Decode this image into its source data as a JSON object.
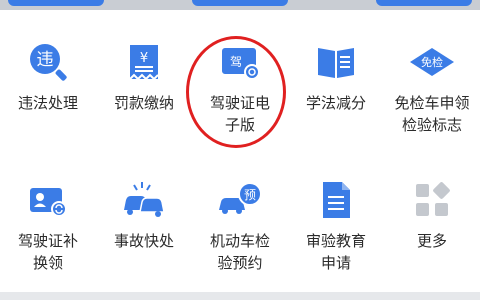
{
  "colors": {
    "accent": "#3b7ce6",
    "highlight_circle": "#e02020"
  },
  "services": [
    {
      "label": "违法处理",
      "icon": "violation-search-icon",
      "icon_text": "违"
    },
    {
      "label": "罚款缴纳",
      "icon": "fine-receipt-icon",
      "icon_text": "¥"
    },
    {
      "label": "驾驶证电子版",
      "icon": "e-license-card-icon",
      "icon_text": "驾"
    },
    {
      "label": "学法减分",
      "icon": "study-book-icon"
    },
    {
      "label": "免检车申领检验标志",
      "icon": "inspection-exempt-icon",
      "icon_text": "免检"
    },
    {
      "label": "驾驶证补换领",
      "icon": "license-renew-icon"
    },
    {
      "label": "事故快处",
      "icon": "accident-cars-icon"
    },
    {
      "label": "机动车检验预约",
      "icon": "vehicle-booking-icon",
      "icon_text": "预"
    },
    {
      "label": "审验教育申请",
      "icon": "document-icon"
    },
    {
      "label": "更多",
      "icon": "more-grid-icon"
    }
  ]
}
